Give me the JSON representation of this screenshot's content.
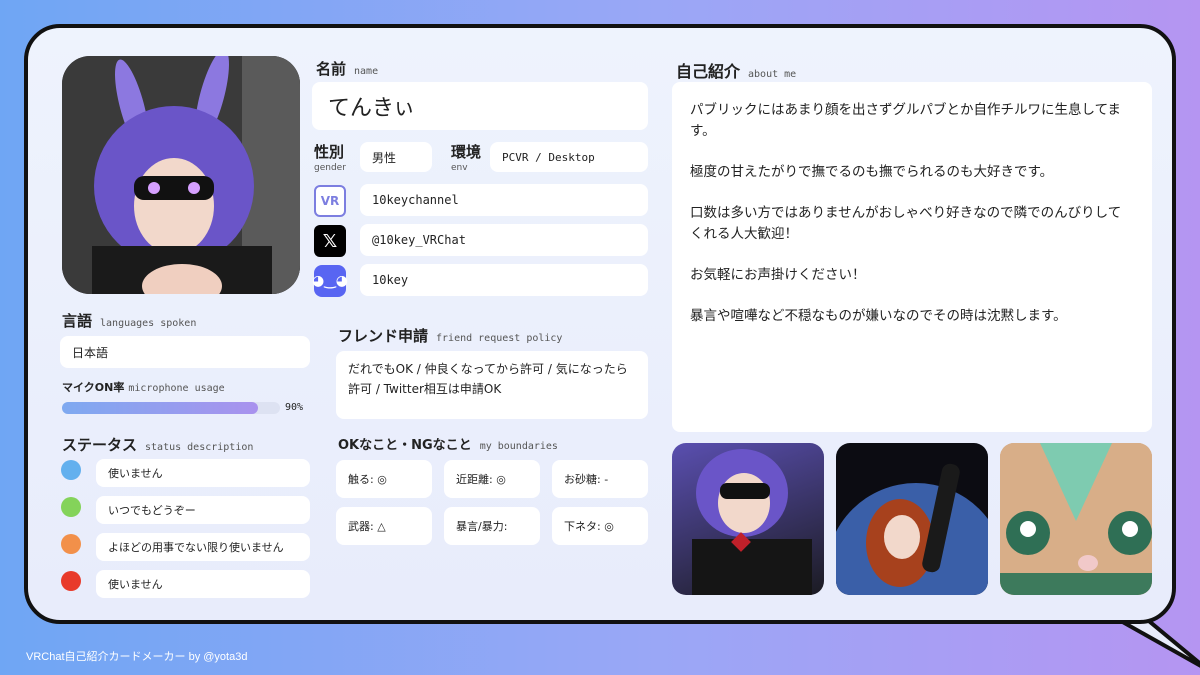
{
  "name": {
    "label": "名前",
    "sub": "name",
    "value": "てんきぃ"
  },
  "gender": {
    "label": "性別",
    "sub": "gender",
    "value": "男性"
  },
  "env": {
    "label": "環境",
    "sub": "env",
    "value": "PCVR / Desktop"
  },
  "socials": {
    "vrchat": {
      "icon": "vrchat-icon",
      "value": "10keychannel"
    },
    "x": {
      "icon": "x-icon",
      "value": "@10key_VRChat"
    },
    "discord": {
      "icon": "discord-icon",
      "value": "10key"
    }
  },
  "languages": {
    "label": "言語",
    "sub": "languages spoken",
    "value": "日本語"
  },
  "mic": {
    "label": "マイクON率",
    "sub": "microphone usage",
    "percent": 90,
    "text": "90%"
  },
  "status": {
    "label": "ステータス",
    "sub": "status description",
    "items": [
      {
        "color": "#63b0ee",
        "text": "使いません"
      },
      {
        "color": "#84d35a",
        "text": "いつでもどうぞー"
      },
      {
        "color": "#f2904a",
        "text": "よほどの用事でない限り使いません"
      },
      {
        "color": "#e83a2a",
        "text": "使いません"
      }
    ]
  },
  "friend": {
    "label": "フレンド申請",
    "sub": "friend request policy",
    "value": "だれでもOK / 仲良くなってから許可 / 気になったら許可 / Twitter相互は申請OK"
  },
  "boundaries": {
    "label": "OKなこと・NGなこと",
    "sub": "my boundaries",
    "items": [
      "触る: ◎",
      "近距離: ◎",
      "お砂糖: -",
      "武器: △",
      "暴言/暴力:",
      "下ネタ: ◎"
    ]
  },
  "about": {
    "label": "自己紹介",
    "sub": "about me",
    "paragraphs": [
      "パブリックにはあまり顔を出さずグルパブとか自作チルワに生息してます。",
      "極度の甘えたがりで撫でるのも撫でられるのも大好きです。",
      "口数は多い方ではありませんがおしゃべり好きなので隣でのんびりしてくれる人大歓迎！",
      "お気軽にお声掛けください！",
      "暴言や喧嘩など不穏なものが嫌いなのでその時は沈黙します。"
    ]
  },
  "footer": "VRChat自己紹介カードメーカー by @yota3d",
  "colors": {
    "accent": "#9a92ee",
    "border": "#111111"
  }
}
